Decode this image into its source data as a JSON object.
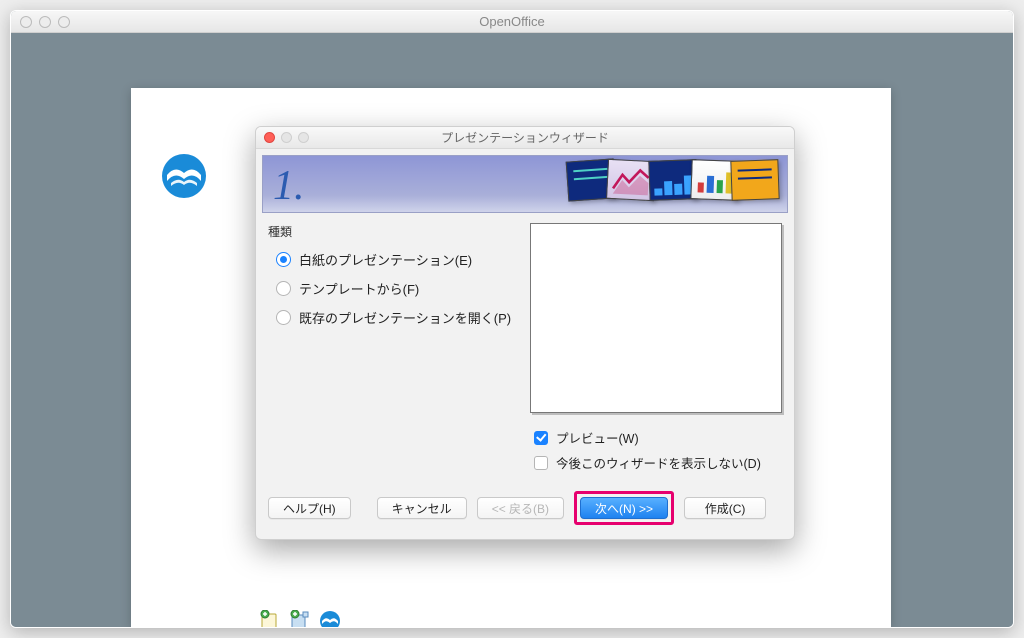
{
  "parent_window": {
    "title": "OpenOffice"
  },
  "dialog": {
    "title": "プレゼンテーションウィザード",
    "step_number": "1.",
    "type_section_label": "種類",
    "radios": [
      {
        "label": "白紙のプレゼンテーション(E)",
        "checked": true
      },
      {
        "label": "テンプレートから(F)",
        "checked": false
      },
      {
        "label": "既存のプレゼンテーションを開く(P)",
        "checked": false
      }
    ],
    "checks": {
      "preview": {
        "label": "プレビュー(W)",
        "checked": true
      },
      "dont_show": {
        "label": "今後このウィザードを表示しない(D)",
        "checked": false
      }
    },
    "buttons": {
      "help": "ヘルプ(H)",
      "cancel": "キャンセル",
      "back": "<< 戻る(B)",
      "next": "次へ(N) >>",
      "create": "作成(C)"
    }
  }
}
